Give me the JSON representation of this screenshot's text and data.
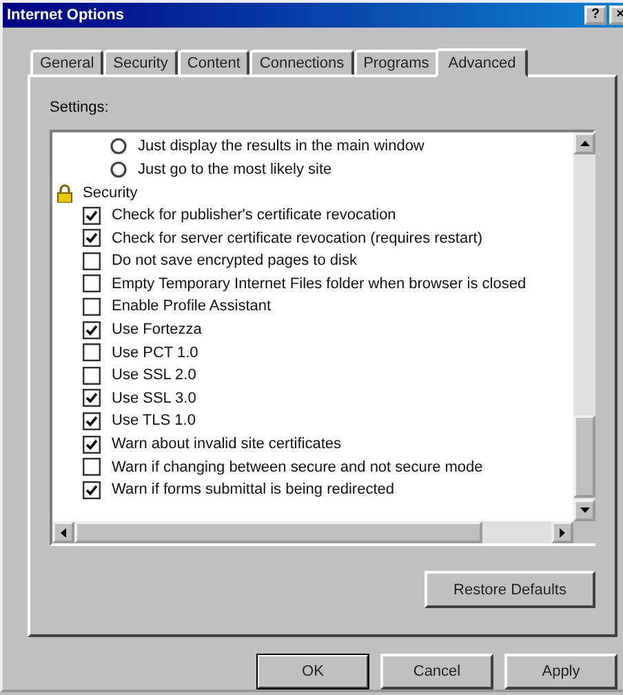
{
  "window": {
    "title": "Internet Options",
    "help_button": "?",
    "close_button": "×"
  },
  "tabs": [
    {
      "label": "General",
      "selected": false
    },
    {
      "label": "Security",
      "selected": false
    },
    {
      "label": "Content",
      "selected": false
    },
    {
      "label": "Connections",
      "selected": false
    },
    {
      "label": "Programs",
      "selected": false
    },
    {
      "label": "Advanced",
      "selected": true
    }
  ],
  "settings": {
    "label": "Settings:",
    "items": [
      {
        "kind": "radio",
        "label": "Just display the results in the main window",
        "selected": false
      },
      {
        "kind": "radio",
        "label": "Just go to the most likely site",
        "selected": false
      },
      {
        "kind": "group",
        "label": "Security",
        "children": [
          {
            "kind": "checkbox",
            "label": "Check for publisher's certificate revocation",
            "checked": true
          },
          {
            "kind": "checkbox",
            "label": "Check for server certificate revocation (requires restart)",
            "checked": true
          },
          {
            "kind": "checkbox",
            "label": "Do not save encrypted pages to disk",
            "checked": false
          },
          {
            "kind": "checkbox",
            "label": "Empty Temporary Internet Files folder when browser is closed",
            "checked": false
          },
          {
            "kind": "checkbox",
            "label": "Enable Profile Assistant",
            "checked": false
          },
          {
            "kind": "checkbox",
            "label": "Use Fortezza",
            "checked": true
          },
          {
            "kind": "checkbox",
            "label": "Use PCT 1.0",
            "checked": false
          },
          {
            "kind": "checkbox",
            "label": "Use SSL 2.0",
            "checked": false
          },
          {
            "kind": "checkbox",
            "label": "Use SSL 3.0",
            "checked": true
          },
          {
            "kind": "checkbox",
            "label": "Use TLS 1.0",
            "checked": true
          },
          {
            "kind": "checkbox",
            "label": "Warn about invalid site certificates",
            "checked": true
          },
          {
            "kind": "checkbox",
            "label": "Warn if changing between secure and not secure mode",
            "checked": false
          },
          {
            "kind": "checkbox",
            "label": "Warn if forms submittal is being redirected",
            "checked": true
          }
        ]
      }
    ]
  },
  "restore_button": "Restore Defaults",
  "buttons": [
    {
      "label": "OK",
      "default": true
    },
    {
      "label": "Cancel",
      "default": false
    },
    {
      "label": "Apply",
      "default": false
    }
  ]
}
